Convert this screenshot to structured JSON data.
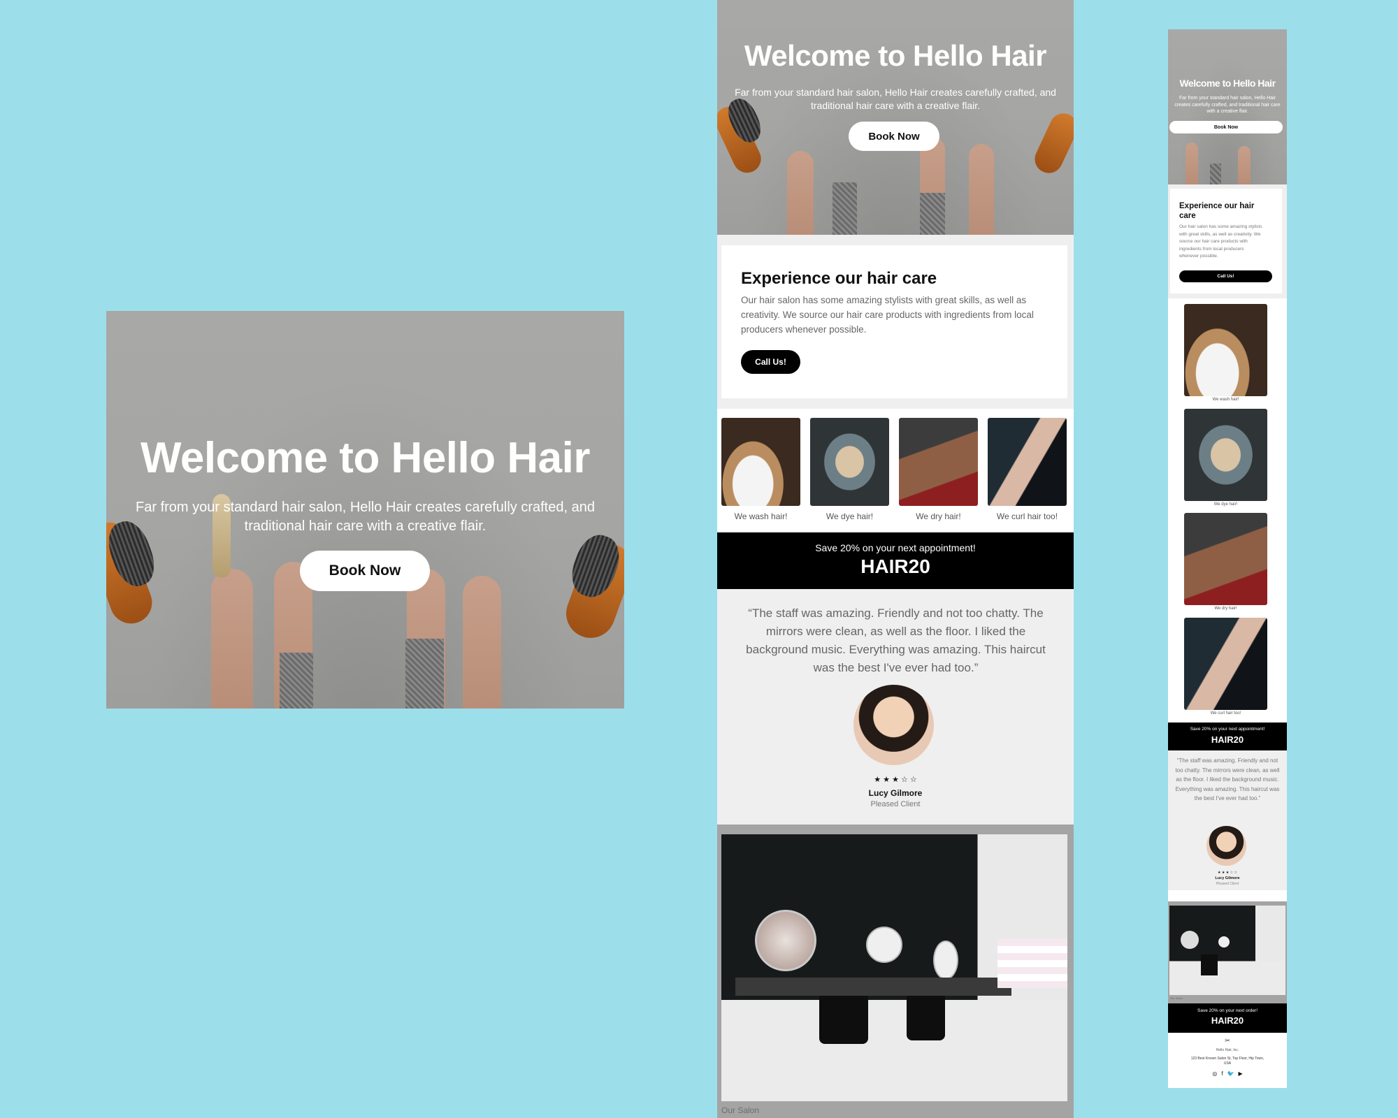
{
  "colors": {
    "canvas": "#9cdfeb",
    "hero_overlay": "#a6a6a4",
    "promo_bg": "#000000",
    "section_bg": "#efefef"
  },
  "desktop": {
    "hero": {
      "title": "Welcome to Hello Hair",
      "subtitle": "Far from your standard hair salon, Hello Hair creates carefully crafted, and traditional hair care with a creative flair.",
      "cta": "Book Now"
    }
  },
  "tablet": {
    "hero": {
      "title": "Welcome to Hello Hair",
      "subtitle": "Far from your standard hair salon, Hello Hair creates carefully crafted, and traditional hair care with a creative flair.",
      "cta": "Book Now"
    },
    "about": {
      "heading": "Experience our hair care",
      "body": "Our hair salon has some amazing stylists with great skills, as well as creativity. We source our hair care products with ingredients from local producers whenever possible.",
      "cta": "Call Us!"
    },
    "services": [
      {
        "caption": "We wash hair!",
        "icon": "wash-photo"
      },
      {
        "caption": "We dye hair!",
        "icon": "dye-photo"
      },
      {
        "caption": "We dry hair!",
        "icon": "dry-photo"
      },
      {
        "caption": "We curl hair too!",
        "icon": "curl-photo"
      }
    ],
    "promo": {
      "text": "Save 20% on your next appointment!",
      "code": "HAIR20"
    },
    "testimonial": {
      "quote": "“The staff was amazing. Friendly and not too chatty. The mirrors were clean, as well as the floor. I liked the background music. Everything was amazing. This haircut was the best I've ever had too.”",
      "rating_text": "★ ★ ★ ☆ ☆",
      "rating": 3,
      "name": "Lucy Gilmore",
      "role": "Pleased Client"
    },
    "gallery": {
      "caption": "Our Salon"
    }
  },
  "mobile": {
    "hero": {
      "title": "Welcome to Hello Hair",
      "subtitle": "Far from your standard hair salon, Hello Hair creates carefully crafted, and traditional hair care with a creative flair.",
      "cta": "Book Now"
    },
    "about": {
      "heading": "Experience our hair care",
      "body": "Our hair salon has some amazing stylists with great skills, as well as creativity. We source our hair care products with ingredients from local producers whenever possible.",
      "cta": "Call Us!"
    },
    "services": [
      {
        "caption": "We wash hair!"
      },
      {
        "caption": "We dye hair!"
      },
      {
        "caption": "We dry hair!"
      },
      {
        "caption": "We curl hair too!"
      }
    ],
    "promo": {
      "text": "Save 20% on your next appointment!",
      "code": "HAIR20"
    },
    "testimonial": {
      "quote": "“The staff was amazing. Friendly and not too chatty. The mirrors were clean, as well as the floor. I liked the background music. Everything was amazing. This haircut was the best I've ever had too.”",
      "rating_text": "★ ★ ★ ☆ ☆",
      "name": "Lucy Gilmore",
      "role": "Pleased Client"
    },
    "gallery": {
      "caption": "Our Salon"
    },
    "promo2": {
      "text": "Save 20% on your next order!",
      "code": "HAIR20"
    },
    "footer": {
      "company": "Hello Hair, Inc.",
      "address": "123 Best Known Salon St, Top Floor, Hip Town, USA",
      "social": [
        "instagram-icon",
        "facebook-icon",
        "twitter-icon",
        "youtube-icon"
      ]
    }
  }
}
